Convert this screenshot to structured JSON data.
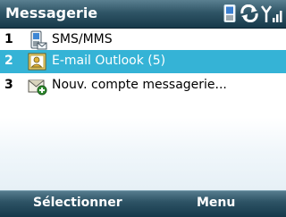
{
  "header": {
    "title": "Messagerie"
  },
  "status_icons": [
    "phone-icon",
    "sync-icon",
    "signal-icon"
  ],
  "list": {
    "items": [
      {
        "number": "1",
        "label": "SMS/MMS",
        "icon": "sms-phone-icon"
      },
      {
        "number": "2",
        "label": "E-mail Outlook (5)",
        "icon": "outlook-mail-icon",
        "selected": true
      },
      {
        "number": "3",
        "label": "Nouv. compte messagerie...",
        "icon": "new-account-icon"
      }
    ]
  },
  "softkeys": {
    "left": "Sélectionner",
    "right": "Menu"
  },
  "colors": {
    "title_bar": "#2f5566",
    "selection": "#35b3d6",
    "softkey_bar": "#2e5466"
  }
}
